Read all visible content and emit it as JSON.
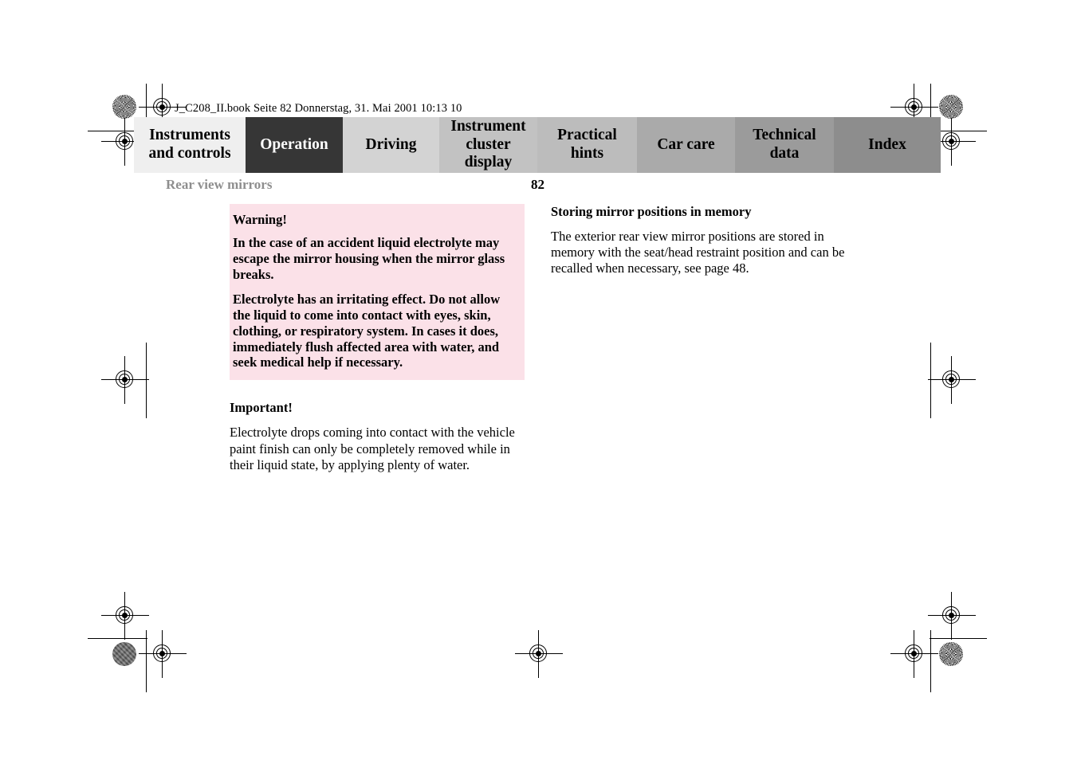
{
  "document": {
    "book_info": "J_C208_II.book  Seite 82  Donnerstag, 31. Mai 2001  10:13 10",
    "section_title": "Rear view mirrors",
    "page_number": "82"
  },
  "tabs": [
    {
      "label": "Instruments and controls",
      "color": "#efefef",
      "active": false
    },
    {
      "label": "Operation",
      "color": "#363636",
      "active": true
    },
    {
      "label": "Driving",
      "color": "#d3d3d3",
      "active": false
    },
    {
      "label": "Instrument cluster display",
      "color": "#c2c2c2",
      "active": false
    },
    {
      "label": "Practical hints",
      "color": "#bcbcbc",
      "active": false
    },
    {
      "label": "Car care",
      "color": "#aaaaaa",
      "active": false
    },
    {
      "label": "Technical data",
      "color": "#9b9b9b",
      "active": false
    },
    {
      "label": "Index",
      "color": "#8d8d8d",
      "active": false
    }
  ],
  "content": {
    "warning": {
      "title": "Warning!",
      "paragraph_1": "In the case of an accident liquid electrolyte may escape the mirror housing when the mirror glass breaks.",
      "paragraph_2": "Electrolyte has an irritating effect. Do not allow the liquid to come into contact with eyes, skin, clothing, or respiratory system. In cases it does, immediately flush affected area with water, and seek medical help if necessary.",
      "background_color": "#fbe1e8"
    },
    "important": {
      "title": "Important!",
      "paragraph": "Electrolyte drops coming into contact with the vehicle paint finish can only be completely removed while in their liquid state, by applying plenty of water."
    },
    "memory": {
      "title": "Storing mirror positions in memory",
      "paragraph": "The exterior rear view mirror positions are stored in memory with the seat/head restraint position and can be recalled when necessary, see page 48."
    }
  }
}
